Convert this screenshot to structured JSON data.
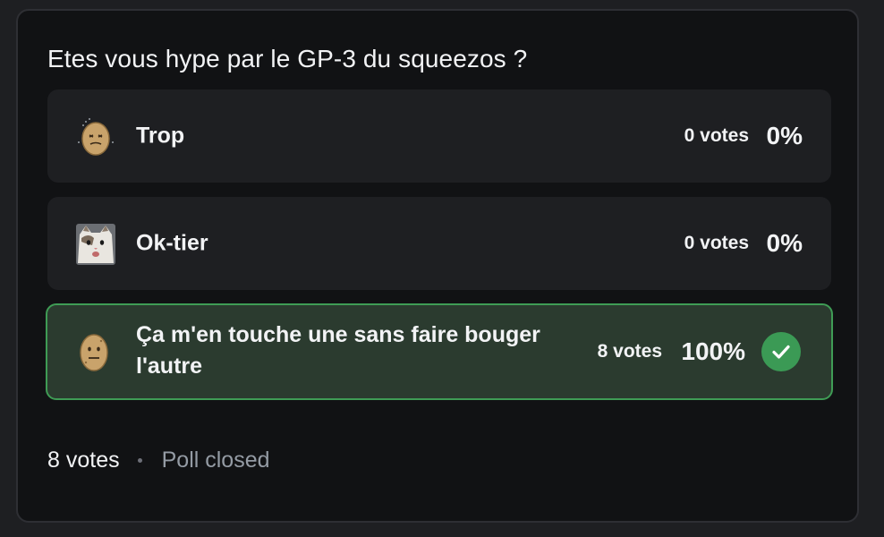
{
  "poll": {
    "question": "Etes vous hype par le GP-3 du squeezos ?",
    "answers": [
      {
        "label": "Trop",
        "emoji": "sweating-potato-emoji",
        "votes": "0 votes",
        "percent": "0%",
        "selected": false
      },
      {
        "label": "Ok-tier",
        "emoji": "cat-emoji",
        "votes": "0 votes",
        "percent": "0%",
        "selected": false
      },
      {
        "label": "Ça m'en touche une sans faire bouger l'autre",
        "emoji": "neutral-potato-emoji",
        "votes": "8 votes",
        "percent": "100%",
        "selected": true
      }
    ],
    "footer": {
      "total_votes": "8 votes",
      "status": "Poll closed"
    }
  },
  "colors": {
    "card_background": "#111214",
    "answer_background": "#1e1f22",
    "winner_background": "#2b3b2f",
    "winner_border": "#3f9c55",
    "check_color": "#3b9a55"
  }
}
